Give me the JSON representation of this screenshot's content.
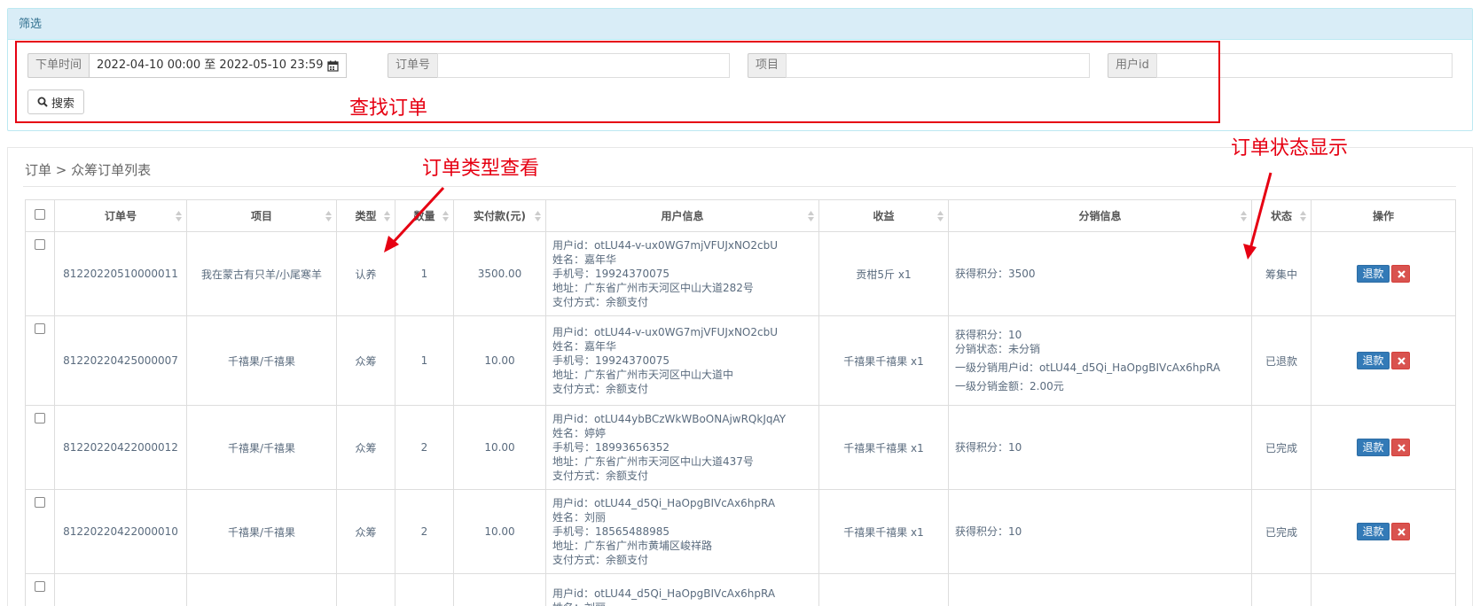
{
  "filter": {
    "heading": "筛选",
    "order_time_label": "下单时间",
    "order_time_value": "2022-04-10 00:00 至 2022-05-10 23:59",
    "order_no_label": "订单号",
    "item_label": "项目",
    "user_id_label": "用户id",
    "search_label": "搜索"
  },
  "annotations": {
    "find_orders": "查找订单",
    "order_type": "订单类型查看",
    "order_status": "订单状态显示",
    "color": "#e60012"
  },
  "breadcrumb": "订单 > 众筹订单列表",
  "table": {
    "columns": [
      "订单号",
      "项目",
      "类型",
      "数量",
      "实付款(元)",
      "用户信息",
      "收益",
      "分销信息",
      "状态",
      "操作"
    ],
    "refund_label": "退款",
    "rows": [
      {
        "order_no": "81220220510000011",
        "item": "我在蒙古有只羊/小尾寒羊",
        "type": "认养",
        "qty": "1",
        "paid": "3500.00",
        "user": [
          "用户id：otLU44-v-ux0WG7mjVFUJxNO2cbU",
          "姓名：嘉年华",
          "手机号：19924370075",
          "地址：广东省广州市天河区中山大道282号",
          "支付方式：余额支付"
        ],
        "income": "贡柑5斤 x1",
        "dist": [
          "获得积分：3500"
        ],
        "status": "筹集中"
      },
      {
        "order_no": "81220220425000007",
        "item": "千禧果/千禧果",
        "type": "众筹",
        "qty": "1",
        "paid": "10.00",
        "user": [
          "用户id：otLU44-v-ux0WG7mjVFUJxNO2cbU",
          "姓名：嘉年华",
          "手机号：19924370075",
          "地址：广东省广州市天河区中山大道中",
          "支付方式：余额支付"
        ],
        "income": "千禧果千禧果 x1",
        "dist": [
          "获得积分：10",
          "分销状态：未分销",
          "",
          "一级分销用户id：otLU44_d5Qi_HaOpgBIVcAx6hpRA",
          "",
          "一级分销金额：2.00元"
        ],
        "status": "已退款"
      },
      {
        "order_no": "81220220422000012",
        "item": "千禧果/千禧果",
        "type": "众筹",
        "qty": "2",
        "paid": "10.00",
        "user": [
          "用户id：otLU44ybBCzWkWBoONAjwRQkJqAY",
          "姓名：婷婷",
          "手机号：18993656352",
          "地址：广东省广州市天河区中山大道437号",
          "支付方式：余额支付"
        ],
        "income": "千禧果千禧果 x1",
        "dist": [
          "获得积分：10"
        ],
        "status": "已完成"
      },
      {
        "order_no": "81220220422000010",
        "item": "千禧果/千禧果",
        "type": "众筹",
        "qty": "2",
        "paid": "10.00",
        "user": [
          "用户id：otLU44_d5Qi_HaOpgBIVcAx6hpRA",
          "姓名：刘丽",
          "手机号：18565488985",
          "地址：广东省广州市黄埔区峻祥路",
          "支付方式：余额支付"
        ],
        "income": "千禧果千禧果 x1",
        "dist": [
          "获得积分：10"
        ],
        "status": "已完成"
      },
      {
        "order_no": "",
        "item": "",
        "type": "",
        "qty": "",
        "paid": "",
        "user": [
          "用户id：otLU44_d5Qi_HaOpgBIVcAx6hpRA",
          "姓名：刘丽"
        ],
        "income": "",
        "dist": [],
        "status": ""
      }
    ]
  }
}
